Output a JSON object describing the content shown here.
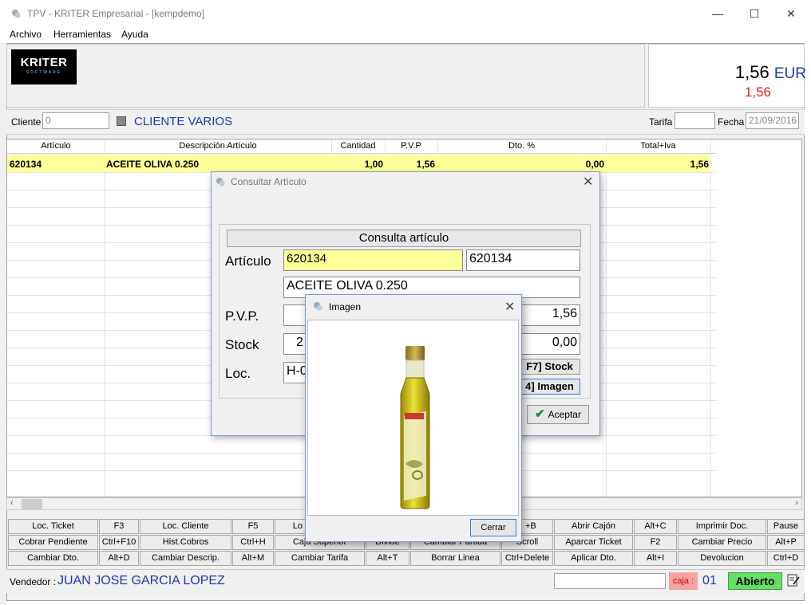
{
  "window": {
    "title": "TPV - KRITER Empresarial -  [kempdemo]",
    "minimize": "—",
    "maximize": "☐",
    "close": "✕"
  },
  "menu": [
    "Archivo",
    "Herramientas",
    "Ayuda"
  ],
  "logo": {
    "line1": "KRITER",
    "line2": "SOFTWARE"
  },
  "total": {
    "amount": "1,56",
    "currency": "EUR",
    "pending": "1,56"
  },
  "client": {
    "label": "Cliente",
    "code": "0",
    "name": "CLIENTE VARIOS",
    "tarifa_label": "Tarifa",
    "tarifa_value": "",
    "fecha_label": "Fecha",
    "fecha_value": "21/09/2016"
  },
  "grid": {
    "columns": [
      "Artículo",
      "Descripción Artículo",
      "Cantidad",
      "P.V.P",
      "Dto. %",
      "Total+Iva"
    ],
    "rows": [
      {
        "articulo": "620134",
        "descripcion": "ACEITE OLIVA 0.250",
        "cantidad": "1,00",
        "pvp": "1,56",
        "dto": "0,00",
        "total": "1,56"
      }
    ]
  },
  "fkeys": {
    "row1": [
      "Loc. Ticket",
      "F3",
      "Loc. Cliente",
      "F5",
      "Lo",
      "+B",
      "Abrir Cajón",
      "Alt+C",
      "Imprimir Doc.",
      "Pause"
    ],
    "row2": [
      "Cobrar Pendiente",
      "Ctrl+F10",
      "Hist.Cobros",
      "Ctrl+H",
      "Caja Superior",
      "Divide",
      "Cambiar Partida",
      "Scroll",
      "Aparcar Ticket",
      "F2",
      "Cambiar Precio",
      "Alt+P"
    ],
    "row3": [
      "Cambiar Dto.",
      "Alt+D",
      "Cambiar Descrip.",
      "Alt+M",
      "Cambiar Tarifa",
      "Alt+T",
      "Borrar Linea",
      "Ctrl+Delete",
      "Aplicar Dto.",
      "Alt+I",
      "Devolucion",
      "Ctrl+D"
    ]
  },
  "status": {
    "vendedor_label": "Vendedor :",
    "vendedor_name": "JUAN JOSE GARCIA LOPEZ",
    "caja_label": "caja :",
    "caja_num": "01",
    "estado": "Abierto"
  },
  "consultar": {
    "title": "Consultar Artículo",
    "header": "Consulta artículo",
    "articulo_label": "Artículo",
    "articulo_code": "620134",
    "articulo_code2": "620134",
    "descripcion": "ACEITE OLIVA 0.250",
    "pvp_label": "P.V.P.",
    "pvp_value": "1,56",
    "stock_label": "Stock",
    "stock_value": "2",
    "dto_value": "0,00",
    "loc_label": "Loc.",
    "loc_value": "H-0",
    "stock_btn": "F7] Stock",
    "imagen_btn": "4] Imagen",
    "aceptar": "Aceptar"
  },
  "imagen": {
    "title": "Imagen",
    "cerrar": "Cerrar"
  }
}
